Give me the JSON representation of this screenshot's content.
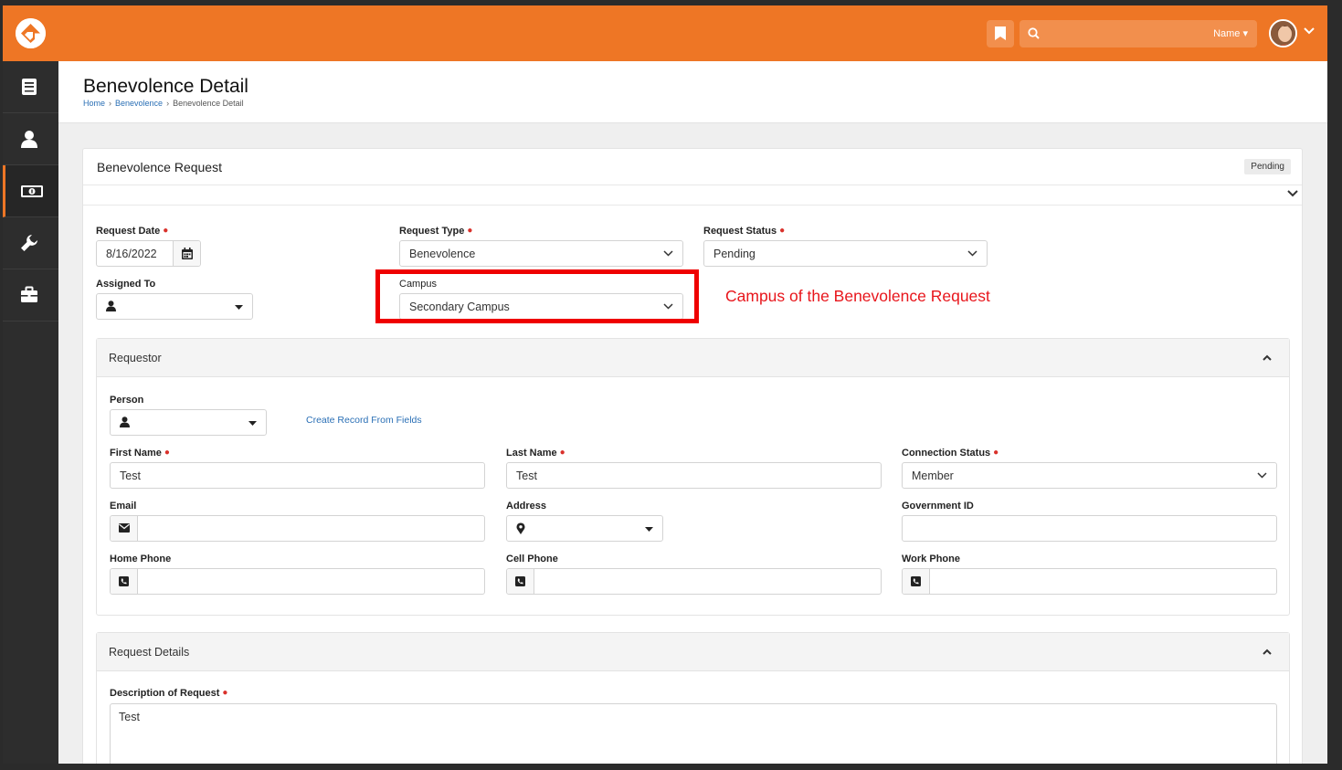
{
  "header": {
    "search": {
      "value": "",
      "filter_label": "Name"
    }
  },
  "page": {
    "title": "Benevolence Detail",
    "breadcrumb": [
      "Home",
      "Benevolence",
      "Benevolence Detail"
    ]
  },
  "panel": {
    "title": "Benevolence Request",
    "status_badge": "Pending"
  },
  "request": {
    "date_label": "Request Date",
    "date_value": "8/16/2022",
    "type_label": "Request Type",
    "type_value": "Benevolence",
    "status_label": "Request Status",
    "status_value": "Pending",
    "assigned_label": "Assigned To",
    "campus_label": "Campus",
    "campus_value": "Secondary Campus"
  },
  "annotation": {
    "text": "Campus of the Benevolence Request"
  },
  "requestor": {
    "title": "Requestor",
    "person_label": "Person",
    "create_link": "Create Record From Fields",
    "first_name_label": "First Name",
    "first_name_value": "Test",
    "last_name_label": "Last Name",
    "last_name_value": "Test",
    "connection_label": "Connection Status",
    "connection_value": "Member",
    "email_label": "Email",
    "address_label": "Address",
    "gov_id_label": "Government ID",
    "home_phone_label": "Home Phone",
    "cell_phone_label": "Cell Phone",
    "work_phone_label": "Work Phone"
  },
  "details": {
    "title": "Request Details",
    "description_label": "Description of Request",
    "description_value": "Test"
  },
  "colors": {
    "brand": "#ee7625",
    "sidebar": "#2d2d2d",
    "link": "#2a6fb5",
    "required": "#d9312b",
    "annotation": "#ef0000"
  }
}
